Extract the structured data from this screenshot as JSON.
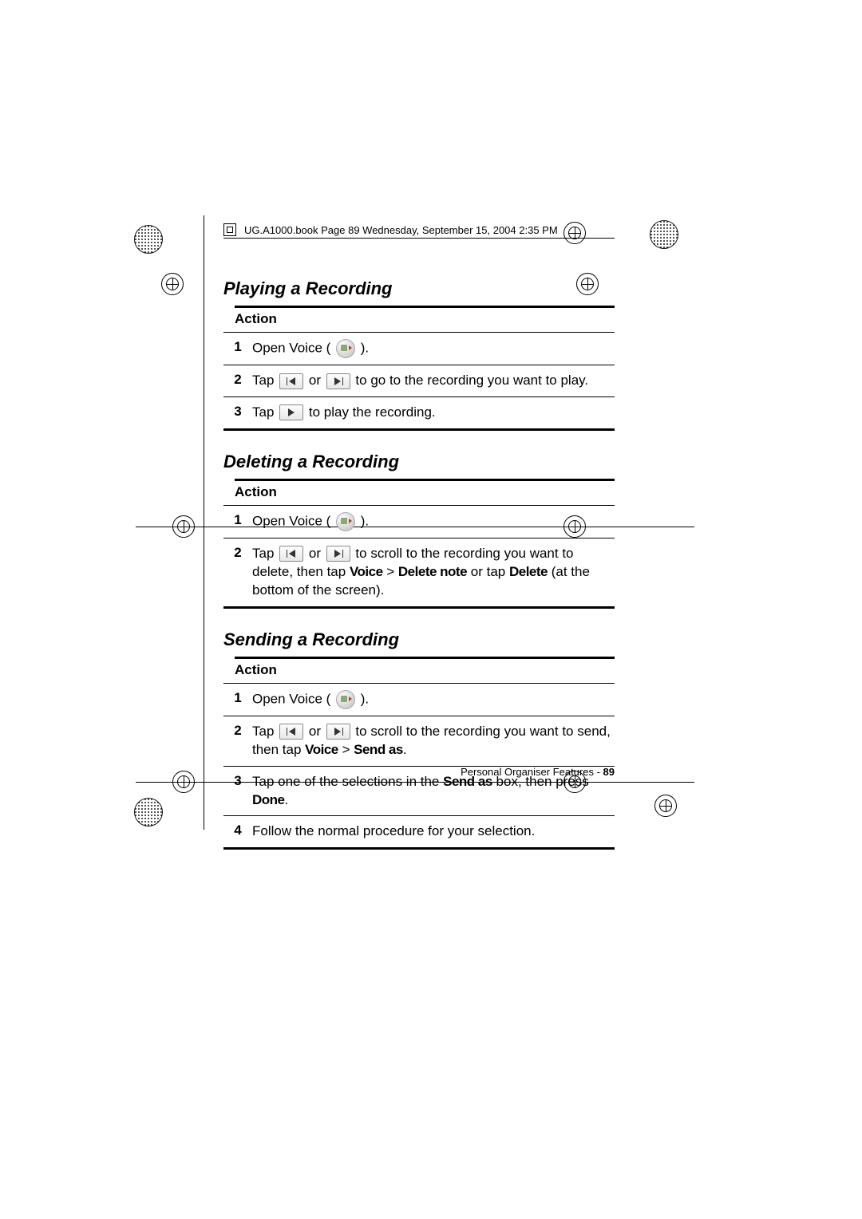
{
  "header": "UG.A1000.book  Page 89  Wednesday, September 15, 2004  2:35 PM",
  "sections": [
    {
      "title": "Playing a Recording",
      "action": "Action",
      "steps": [
        {
          "n": "1",
          "parts": [
            {
              "t": "text",
              "v": "Open Voice ( "
            },
            {
              "t": "voice"
            },
            {
              "t": "text",
              "v": " )."
            }
          ]
        },
        {
          "n": "2",
          "parts": [
            {
              "t": "text",
              "v": "Tap "
            },
            {
              "t": "prev"
            },
            {
              "t": "text",
              "v": " or "
            },
            {
              "t": "next"
            },
            {
              "t": "text",
              "v": " to go to the recording you want to play."
            }
          ]
        },
        {
          "n": "3",
          "parts": [
            {
              "t": "text",
              "v": "Tap "
            },
            {
              "t": "play"
            },
            {
              "t": "text",
              "v": " to play the recording."
            }
          ]
        }
      ]
    },
    {
      "title": "Deleting a Recording",
      "action": "Action",
      "steps": [
        {
          "n": "1",
          "parts": [
            {
              "t": "text",
              "v": "Open Voice ( "
            },
            {
              "t": "voice"
            },
            {
              "t": "text",
              "v": " )."
            }
          ]
        },
        {
          "n": "2",
          "parts": [
            {
              "t": "text",
              "v": "Tap "
            },
            {
              "t": "prev"
            },
            {
              "t": "text",
              "v": " or "
            },
            {
              "t": "next"
            },
            {
              "t": "text",
              "v": " to scroll to the recording you want to delete, then tap "
            },
            {
              "t": "bold",
              "v": "Voice"
            },
            {
              "t": "text",
              "v": " > "
            },
            {
              "t": "bold",
              "v": "Delete note"
            },
            {
              "t": "text",
              "v": " or tap "
            },
            {
              "t": "bold",
              "v": "Delete"
            },
            {
              "t": "text",
              "v": " (at the bottom of the screen)."
            }
          ]
        }
      ]
    },
    {
      "title": "Sending a Recording",
      "action": "Action",
      "steps": [
        {
          "n": "1",
          "parts": [
            {
              "t": "text",
              "v": "Open Voice ( "
            },
            {
              "t": "voice"
            },
            {
              "t": "text",
              "v": " )."
            }
          ]
        },
        {
          "n": "2",
          "parts": [
            {
              "t": "text",
              "v": "Tap "
            },
            {
              "t": "prev"
            },
            {
              "t": "text",
              "v": " or "
            },
            {
              "t": "next"
            },
            {
              "t": "text",
              "v": " to scroll to the recording you want to send, then tap "
            },
            {
              "t": "bold",
              "v": "Voice"
            },
            {
              "t": "text",
              "v": " > "
            },
            {
              "t": "bold",
              "v": "Send as"
            },
            {
              "t": "text",
              "v": "."
            }
          ]
        },
        {
          "n": "3",
          "parts": [
            {
              "t": "text",
              "v": "Tap one of the selections in the "
            },
            {
              "t": "bold",
              "v": "Send as"
            },
            {
              "t": "text",
              "v": " box, then press "
            },
            {
              "t": "bold",
              "v": "Done"
            },
            {
              "t": "text",
              "v": "."
            }
          ]
        },
        {
          "n": "4",
          "parts": [
            {
              "t": "text",
              "v": "Follow the normal procedure for your selection."
            }
          ]
        }
      ]
    }
  ],
  "footer": {
    "label": "Personal Organiser Features - ",
    "page": "89"
  }
}
